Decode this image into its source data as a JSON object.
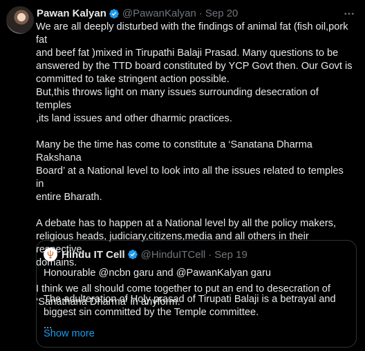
{
  "tweet": {
    "author_name": "Pawan Kalyan",
    "author_handle": "@PawanKalyan",
    "date": "Sep 20",
    "separator": "·",
    "paragraphs": [
      [
        "We are all  deeply disturbed with the findings of animal fat (fish oil,pork fat",
        "and beef fat )mixed  in Tirupathi Balaji Prasad. Many questions to be",
        "answered by the TTD board constituted by YCP Govt then. Our Govt is",
        "committed to take stringent action possible.",
        "But,this throws light on many issues surrounding desecration of temples",
        ",its  land issues and other dharmic practices."
      ],
      [
        "Many be the time has come to constitute a  ‘Sanatana Dharma Rakshana",
        "Board’ at a National level to look into all the issues related to temples in",
        "entire Bharath."
      ],
      [
        "A debate has to happen at a National level by all the policy makers,",
        "religious heads, judiciary,citizens,media and all others in their respective",
        "domains."
      ],
      [
        "I think we all should come together to put an end to desecration of",
        "‘Sanathana Dharma’ in anyform."
      ]
    ]
  },
  "quote": {
    "author_name": "Hindu IT Cell",
    "author_handle": "@HinduITCell",
    "date": "Sep 19",
    "separator": "·",
    "line1": "Honourable @ncbn garu and @PawanKalyan garu",
    "line2a": "The adulteration of Holy prasad of Tirupati Balaji is a betrayal and",
    "line2b": "biggest sin committed by the Temple committee.",
    "ellipsis": "...",
    "show_more": "Show more"
  },
  "icons": {
    "verified": "verified-badge-icon",
    "more": "more-options-icon",
    "quote_avatar": "trident-logo-icon"
  },
  "colors": {
    "background": "#000000",
    "text": "#e7e9ea",
    "muted": "#71767b",
    "accent": "#1d9bf0",
    "border": "#2f3336"
  }
}
